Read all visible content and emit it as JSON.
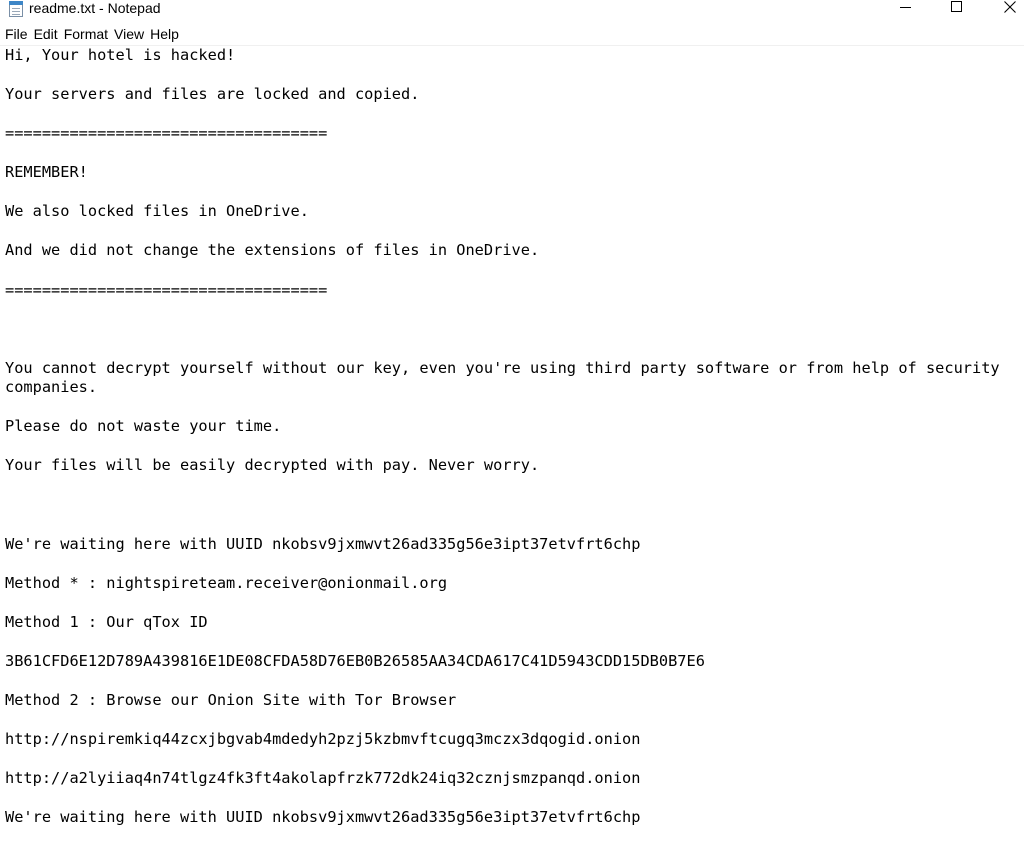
{
  "window": {
    "title": "readme.txt - Notepad",
    "icon": "notepad-icon"
  },
  "menu": [
    "File",
    "Edit",
    "Format",
    "View",
    "Help"
  ],
  "editor": {
    "lines": [
      "Hi, Your hotel is hacked!",
      "",
      "Your servers and files are locked and copied.",
      "",
      "===================================",
      "",
      "REMEMBER!",
      "",
      "We also locked files in OneDrive.",
      "",
      "And we did not change the extensions of files in OneDrive.",
      "",
      "===================================",
      "",
      "",
      "",
      "You cannot decrypt yourself without our key, even you're using third party software or from help of security",
      "companies.",
      "",
      "Please do not waste your time.",
      "",
      "Your files will be easily decrypted with pay. Never worry.",
      "",
      "",
      "",
      "We're waiting here with UUID nkobsv9jxmwvt26ad335g56e3ipt37etvfrt6chp",
      "",
      "Method * : nightspireteam.receiver@onionmail.org",
      "",
      "Method 1 : Our qTox ID",
      "",
      "3B61CFD6E12D789A439816E1DE08CFDA58D76EB0B26585AA34CDA617C41D5943CDD15DB0B7E6",
      "",
      "Method 2 : Browse our Onion Site with Tor Browser",
      "",
      "http://nspiremkiq44zcxjbgvab4mdedyh2pzj5kzbmvftcugq3mczx3dqogid.onion",
      "",
      "http://a2lyiiaq4n74tlgz4fk3ft4akolapfrzk772dk24iq32cznjsmzpanqd.onion",
      "",
      "We're waiting here with UUID nkobsv9jxmwvt26ad335g56e3ipt37etvfrt6chp"
    ]
  }
}
